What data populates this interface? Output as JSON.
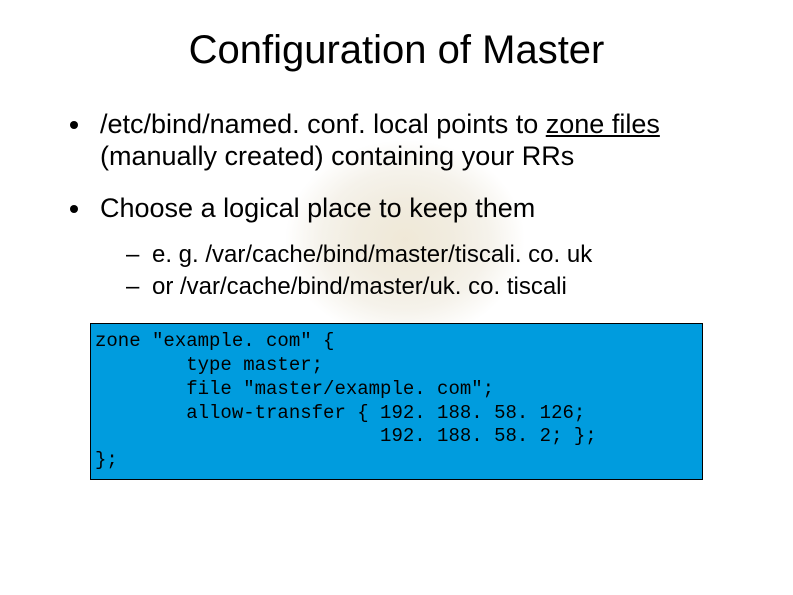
{
  "title": "Configuration of Master",
  "bullets": {
    "item1_a": "/etc/bind/named. conf. local points to ",
    "item1_b": "zone files",
    "item1_c": " (manually created) containing your RRs",
    "item2": "Choose a logical place to keep them",
    "sub1": "e. g. /var/cache/bind/master/tiscali. co. uk",
    "sub2": "or   /var/cache/bind/master/uk. co. tiscali"
  },
  "code": "zone \"example. com\" {\n        type master;\n        file \"master/example. com\";\n        allow-transfer { 192. 188. 58. 126;\n                         192. 188. 58. 2; };\n};"
}
